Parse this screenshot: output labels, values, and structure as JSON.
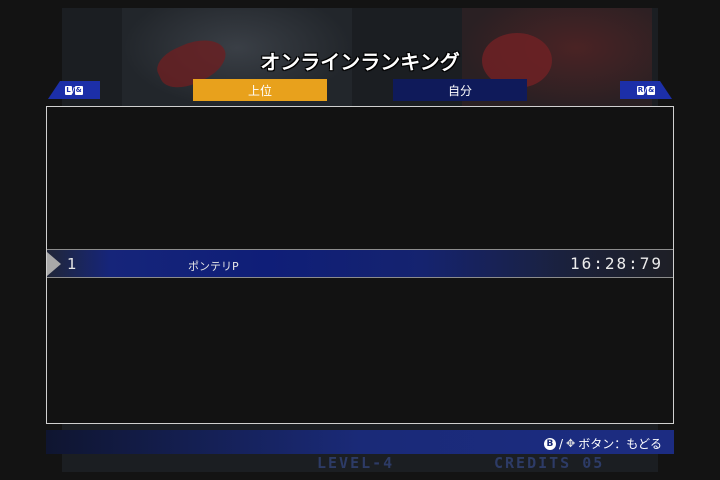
{
  "screen": {
    "title": "オンラインランキング"
  },
  "tabs": [
    {
      "label": "上位",
      "selected": true
    },
    {
      "label": "自分",
      "selected": false
    }
  ],
  "shoulder_buttons": {
    "left": {
      "key1": "L",
      "separator": "/",
      "key2": "&"
    },
    "right": {
      "key1": "R",
      "separator": "/",
      "key2": "&"
    }
  },
  "ranking": {
    "rows": [
      {
        "rank": "1",
        "name": "ポンテリP",
        "time": "16:28:79"
      }
    ]
  },
  "background_hud": {
    "level": "LEVEL-4",
    "credits": "CREDITS 05"
  },
  "footer": {
    "button_glyph": "B",
    "separator": "/",
    "hint": "ボタン：もどる"
  },
  "colors": {
    "tab_selected": "#e8a11c",
    "tab_unselected": "#0f1a5a",
    "accent_blue": "#1c2fa8"
  }
}
